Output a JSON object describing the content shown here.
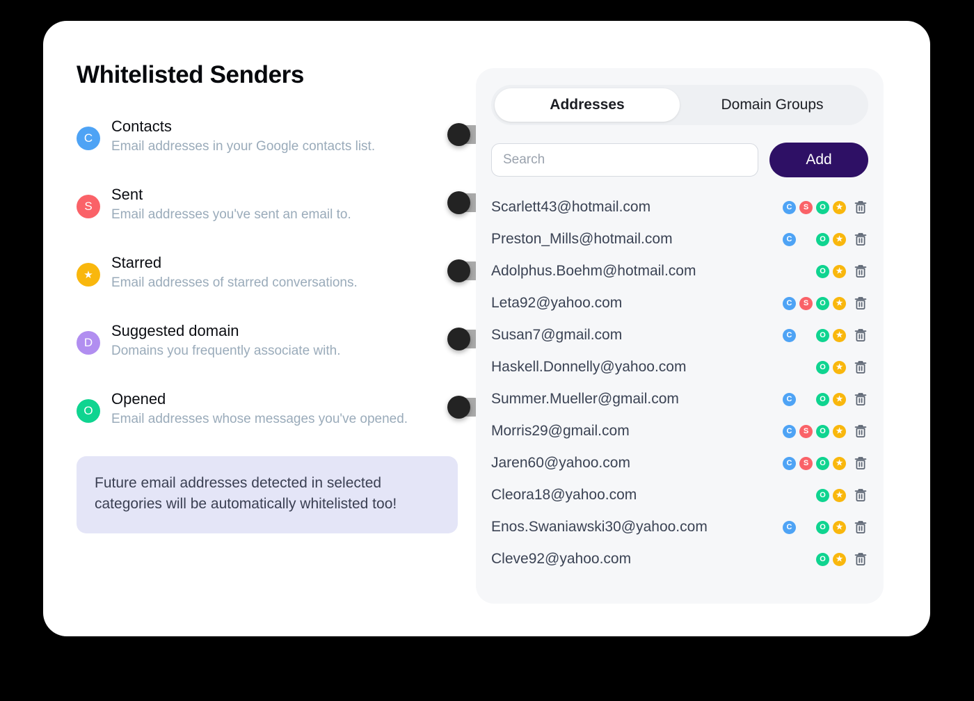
{
  "page": {
    "title": "Whitelisted Senders",
    "background_color": "#000000",
    "card_color": "#ffffff"
  },
  "categories": {
    "items": [
      {
        "key": "contacts",
        "initial": "C",
        "color": "#4ea3f5",
        "title": "Contacts",
        "description": "Email addresses in your Google contacts list.",
        "toggle_on": false
      },
      {
        "key": "sent",
        "initial": "S",
        "color": "#fa6268",
        "title": "Sent",
        "description": "Email addresses you've sent an email to.",
        "toggle_on": false
      },
      {
        "key": "starred",
        "initial": "star",
        "color": "#f9b70d",
        "title": "Starred",
        "description": "Email addresses of starred conversations.",
        "toggle_on": false
      },
      {
        "key": "suggested-domain",
        "initial": "D",
        "color": "#b18ef0",
        "title": "Suggested domain",
        "description": "Domains you frequently associate with.",
        "toggle_on": false
      },
      {
        "key": "opened",
        "initial": "O",
        "color": "#0fd490",
        "title": "Opened",
        "description": "Email addresses whose messages you've opened.",
        "toggle_on": false
      }
    ]
  },
  "info_box": {
    "text": "Future email addresses detected in selected categories will be automatically whitelisted too!",
    "background_color": "#e4e5f7"
  },
  "panel": {
    "tabs": [
      {
        "key": "addresses",
        "label": "Addresses",
        "active": true
      },
      {
        "key": "domain-groups",
        "label": "Domain Groups",
        "active": false
      }
    ],
    "search": {
      "placeholder": "Search",
      "value": ""
    },
    "add_button": {
      "label": "Add",
      "color": "#2e1065"
    },
    "tag_colors": {
      "C": "#4ea3f5",
      "S": "#fa6268",
      "O": "#0fd490",
      "star": "#f9b70d"
    },
    "delete_icon": "trash-icon",
    "addresses": [
      {
        "email": "Scarlett43@hotmail.com",
        "tags": [
          "C",
          "S",
          "O",
          "star"
        ]
      },
      {
        "email": "Preston_Mills@hotmail.com",
        "tags": [
          "C",
          "",
          "O",
          "star"
        ]
      },
      {
        "email": "Adolphus.Boehm@hotmail.com",
        "tags": [
          "",
          "",
          "O",
          "star"
        ]
      },
      {
        "email": "Leta92@yahoo.com",
        "tags": [
          "C",
          "S",
          "O",
          "star"
        ]
      },
      {
        "email": "Susan7@gmail.com",
        "tags": [
          "C",
          "",
          "O",
          "star"
        ]
      },
      {
        "email": "Haskell.Donnelly@yahoo.com",
        "tags": [
          "",
          "",
          "O",
          "star"
        ]
      },
      {
        "email": "Summer.Mueller@gmail.com",
        "tags": [
          "C",
          "",
          "O",
          "star"
        ]
      },
      {
        "email": "Morris29@gmail.com",
        "tags": [
          "C",
          "S",
          "O",
          "star"
        ]
      },
      {
        "email": "Jaren60@yahoo.com",
        "tags": [
          "C",
          "S",
          "O",
          "star"
        ]
      },
      {
        "email": "Cleora18@yahoo.com",
        "tags": [
          "",
          "",
          "O",
          "star"
        ]
      },
      {
        "email": "Enos.Swaniawski30@yahoo.com",
        "tags": [
          "C",
          "",
          "O",
          "star"
        ]
      },
      {
        "email": "Cleve92@yahoo.com",
        "tags": [
          "",
          "",
          "O",
          "star"
        ]
      }
    ]
  }
}
